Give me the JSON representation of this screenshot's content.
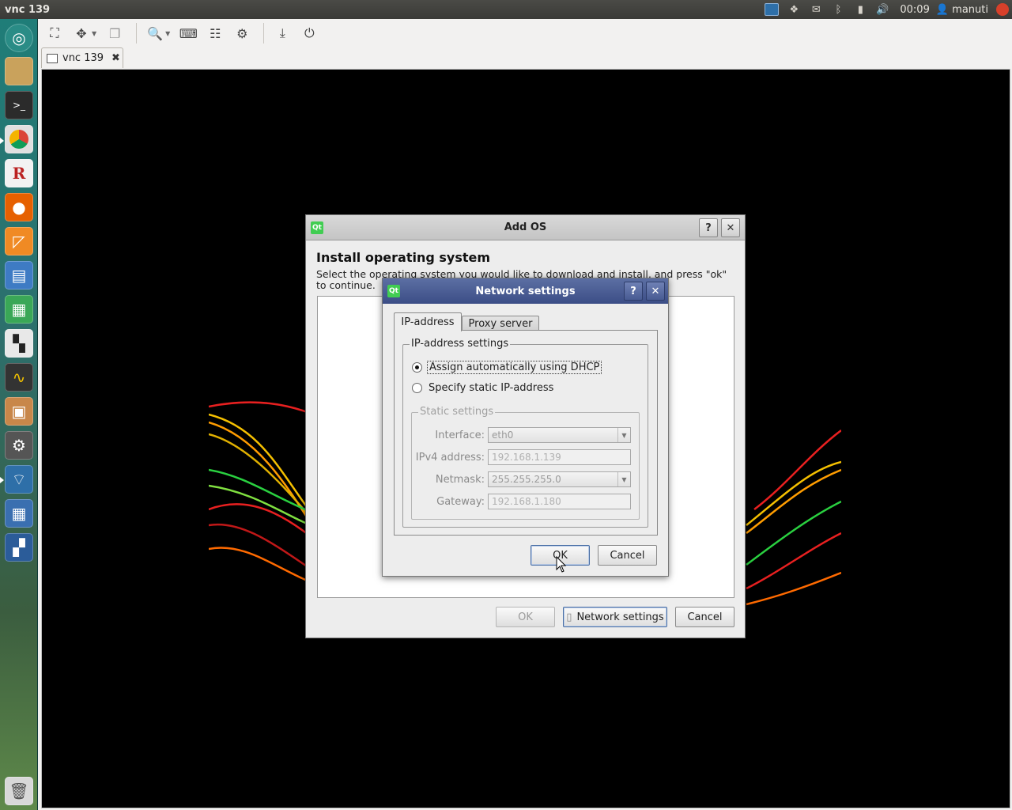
{
  "top_panel": {
    "app_title": "vnc 139",
    "clock": "00:09",
    "username": "manuti"
  },
  "toolbar": {
    "icons": [
      "fullscreen-icon",
      "scale-icon",
      "dropdown-icon",
      "windows-icon",
      "zoom-icon",
      "dropdown-icon",
      "grab-keyboard-icon",
      "preferences-icon",
      "settings-gear-icon",
      "download-icon",
      "disconnect-icon"
    ]
  },
  "tab": {
    "label": "vnc 139",
    "close": "✖"
  },
  "add_os": {
    "title": "Add OS",
    "help": "?",
    "close": "✕",
    "heading": "Install operating system",
    "description": "Select the operating system you would like to download and install, and press \"ok\" to continue.",
    "ok_label": "OK",
    "network_settings_label": "Network settings",
    "cancel_label": "Cancel"
  },
  "network_settings": {
    "title": "Network settings",
    "help": "?",
    "close": "✕",
    "tabs": [
      {
        "label": "IP-address",
        "active": true
      },
      {
        "label": "Proxy server",
        "active": false
      }
    ],
    "group_title": "IP-address settings",
    "radio_dhcp": "Assign automatically using DHCP",
    "radio_static": "Specify static IP-address",
    "static_group_title": "Static settings",
    "fields": {
      "interface_label": "Interface:",
      "interface_value": "eth0",
      "ipv4_label": "IPv4 address:",
      "ipv4_value": "192.168.1.139",
      "netmask_label": "Netmask:",
      "netmask_value": "255.255.255.0",
      "gateway_label": "Gateway:",
      "gateway_value": "192.168.1.180"
    },
    "ok_label": "OK",
    "cancel_label": "Cancel"
  },
  "colors": {
    "launcher_top": "#1f7d78",
    "network_titlebar": "#3b4d86",
    "qt_green": "#41cd52"
  }
}
